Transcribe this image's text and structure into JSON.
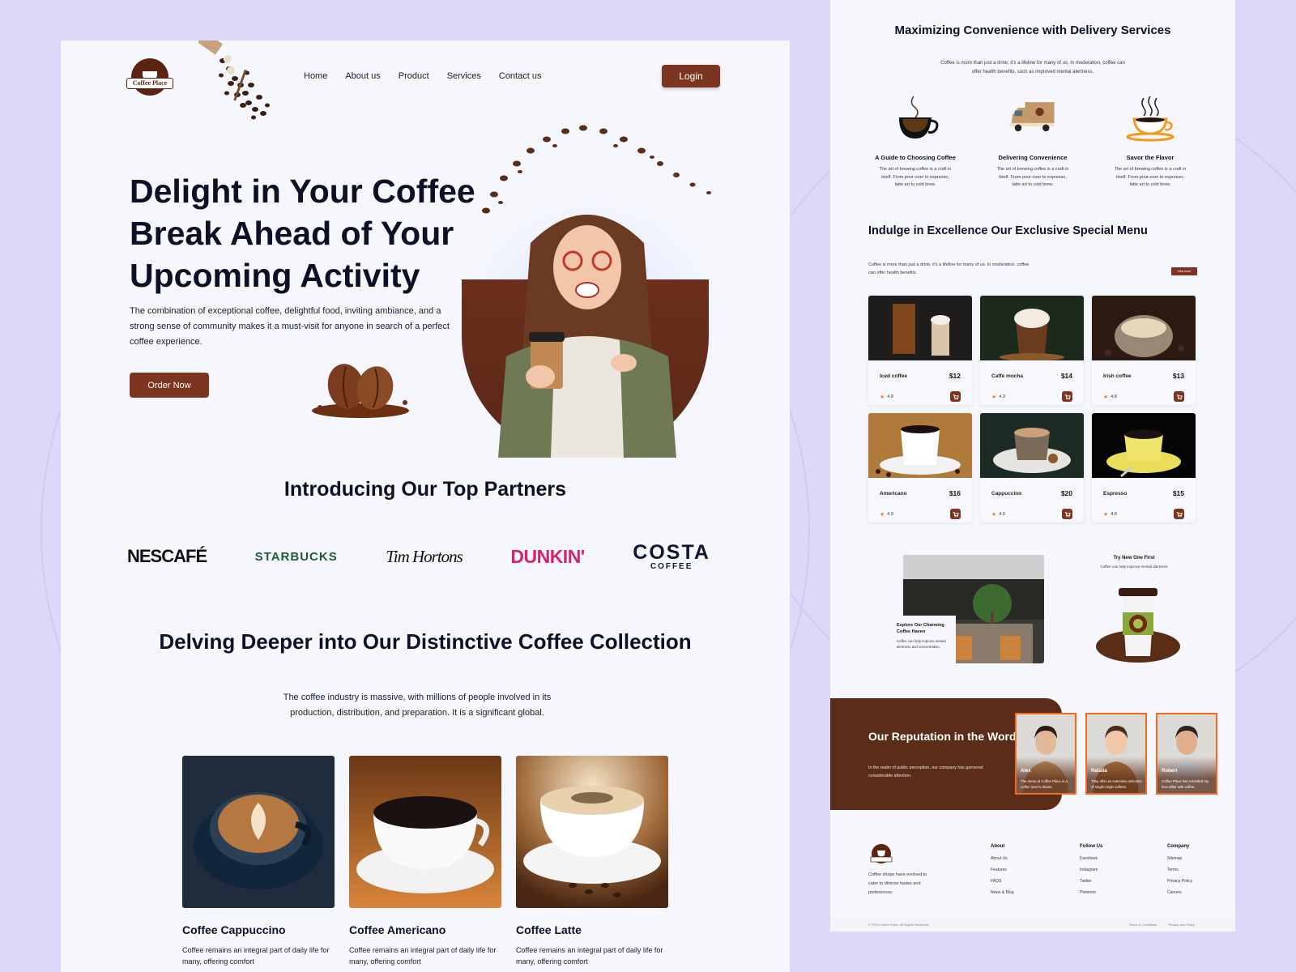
{
  "brand": {
    "name": "Coffee Place",
    "primary_color": "#7b3520",
    "dark_brown": "#5b2c17",
    "accent_orange": "#f06a21",
    "text_color": "#0f1025"
  },
  "nav": {
    "links": [
      "Home",
      "About us",
      "Product",
      "Services",
      "Contact us"
    ],
    "login_label": "Login"
  },
  "hero": {
    "title": "Delight in Your Coffee Break Ahead of Your Upcoming Activity",
    "description": "The combination of exceptional coffee, delightful food, inviting ambiance, and a strong sense of community makes it a must-visit for anyone in search of a perfect coffee experience.",
    "order_button": "Order Now"
  },
  "partners": {
    "title": "Introducing Our Top Partners",
    "logos": [
      {
        "name": "NESCAFÉ",
        "icon": "nescafe-logo"
      },
      {
        "name": "STARBUCKS",
        "icon": "starbucks-logo"
      },
      {
        "name": "Tim Hortons",
        "icon": "tim-hortons-logo"
      },
      {
        "name": "DUNKIN'",
        "icon": "dunkin-logo"
      },
      {
        "name": "COSTA",
        "sub": "COFFEE",
        "icon": "costa-logo"
      }
    ]
  },
  "collection": {
    "title": "Delving Deeper into Our Distinctive Coffee Collection",
    "description": "The coffee industry is massive, with millions of people involved in its production, distribution, and preparation. It is a significant global.",
    "products": [
      {
        "name": "Coffee Cappuccino",
        "desc": "Coffee remains an integral part of daily life for many, offering comfort"
      },
      {
        "name": "Coffee Americano",
        "desc": "Coffee remains an integral part of daily life for many, offering comfort"
      },
      {
        "name": "Coffee Latte",
        "desc": "Coffee remains an integral part of daily life for many, offering comfort"
      }
    ]
  },
  "delivery": {
    "title": "Maximizing Convenience with Delivery Services",
    "subtitle": "Coffee is more than just a drink; it's a lifeline for many of us. In moderation, coffee can offer health benefits, such as improved mental alertness.",
    "features": [
      {
        "title": "A Guide to Choosing Coffee",
        "desc": "The art of brewing coffee is a craft in itself. From pour-over to espresso, latte art to cold brew.",
        "icon": "coffee-cup-icon"
      },
      {
        "title": "Delivering Convenience",
        "desc": "The art of brewing coffee is a craft in itself. From pour-over to espresso, latte art to cold brew.",
        "icon": "delivery-truck-icon"
      },
      {
        "title": "Savor the Flavor",
        "desc": "The art of brewing coffee is a craft in itself. From pour-over to espresso, latte art to cold brew.",
        "icon": "steaming-cup-icon"
      }
    ]
  },
  "menu": {
    "title": "Indulge in Excellence Our Exclusive Special Menu",
    "description": "Coffee is more than just a drink; it's a lifeline for many of us. In moderation, coffee can offer health benefits.",
    "view_more": "View more",
    "items": [
      {
        "name": "Iced coffee",
        "price": "$12",
        "rating": "4.8"
      },
      {
        "name": "Caffe mocha",
        "price": "$14",
        "rating": "4.9"
      },
      {
        "name": "Irish coffee",
        "price": "$13",
        "rating": "4.8"
      },
      {
        "name": "Americano",
        "price": "$16",
        "rating": "4.9"
      },
      {
        "name": "Cappuccino",
        "price": "$20",
        "rating": "4.9"
      },
      {
        "name": "Espresso",
        "price": "$15",
        "rating": "4.8"
      }
    ]
  },
  "haven": {
    "title": "Explore Our Charming Coffee Haven",
    "description": "Coffee can help improve mental alertness and concentration."
  },
  "try_new": {
    "title": "Try New One First",
    "description": "Coffee can help improve mental alertness"
  },
  "reputation": {
    "title": "Our Reputation in the Words of Others",
    "description": "In the realm of public perception, our company has garnered considerable attention.",
    "testimonials": [
      {
        "name": "Alex",
        "text": "The menu at Coffee Place is a coffee lover's dream."
      },
      {
        "name": "Natalia",
        "text": "They offer an extensive selection of single-origin coffees."
      },
      {
        "name": "Robert",
        "text": "Coffee Place has rekindled my love affair with coffee."
      }
    ]
  },
  "footer": {
    "about_text": "Coffee shops have evolved to cater to diverse tastes and preferences.",
    "columns": [
      {
        "title": "About",
        "links": [
          "About Us",
          "Features",
          "FAQS",
          "News & Blog"
        ]
      },
      {
        "title": "Follow Us",
        "links": [
          "Facebook",
          "Instagram",
          "Twitter",
          "Pinterest"
        ]
      },
      {
        "title": "Company",
        "links": [
          "Sitemap",
          "Terms",
          "Privacy Policy",
          "Careers"
        ]
      }
    ],
    "copyright": "© 2023 Coffee Place, All Rights Reserved.",
    "bottom_links": [
      "Terms & Conditions",
      "Privacy and Policy"
    ]
  }
}
